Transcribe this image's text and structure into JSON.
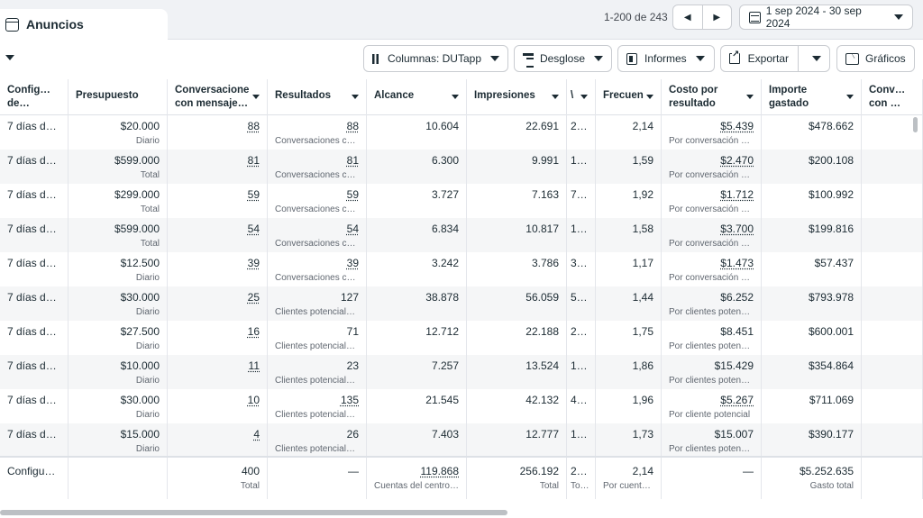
{
  "header": {
    "tab_label": "Anuncios",
    "pager_text": "1-200 de 243",
    "prev_icon": "◀",
    "next_icon": "▶",
    "date_range": "1 sep 2024 - 30 sep 2024"
  },
  "toolbar": {
    "columns_label": "Columnas: DUTapp",
    "breakdown_label": "Desglose",
    "reports_label": "Informes",
    "export_label": "Exportar",
    "charts_label": "Gráficos"
  },
  "columns": [
    {
      "label": "Configura\nde…",
      "caret": false
    },
    {
      "label": "Presupuesto",
      "caret": false
    },
    {
      "label": "Conversacione\ncon mensaje…",
      "caret": true
    },
    {
      "label": "Resultados",
      "caret": true
    },
    {
      "label": "Alcance",
      "caret": true
    },
    {
      "label": "Impresiones",
      "caret": true
    },
    {
      "label": "\\",
      "caret": true
    },
    {
      "label": "Frecuen",
      "caret": true
    },
    {
      "label": "Costo por\nresultado",
      "caret": true
    },
    {
      "label": "Importe\ngastado",
      "caret": true
    },
    {
      "label": "Conversaci\ncon mensa",
      "caret": false
    }
  ],
  "rows": [
    {
      "config": "7 días d…",
      "budget": "$20.000",
      "budget_type": "Diario",
      "conversations": "88",
      "results": "88",
      "results_type": "Conversaciones co…",
      "reach": "10.604",
      "impressions": "22.691",
      "col7": "2…",
      "frequency": "2,14",
      "cost": "$5.439",
      "cost_type": "Por conversación c…",
      "spent": "$478.662"
    },
    {
      "config": "7 días d…",
      "budget": "$599.000",
      "budget_type": "Total",
      "conversations": "81",
      "results": "81",
      "results_type": "Conversaciones co…",
      "reach": "6.300",
      "impressions": "9.991",
      "col7": "1…",
      "frequency": "1,59",
      "cost": "$2.470",
      "cost_type": "Por conversación c…",
      "spent": "$200.108"
    },
    {
      "config": "7 días d…",
      "budget": "$299.000",
      "budget_type": "Total",
      "conversations": "59",
      "results": "59",
      "results_type": "Conversaciones co…",
      "reach": "3.727",
      "impressions": "7.163",
      "col7": "7…",
      "frequency": "1,92",
      "cost": "$1.712",
      "cost_type": "Por conversación c…",
      "spent": "$100.992"
    },
    {
      "config": "7 días d…",
      "budget": "$599.000",
      "budget_type": "Total",
      "conversations": "54",
      "results": "54",
      "results_type": "Conversaciones co…",
      "reach": "6.834",
      "impressions": "10.817",
      "col7": "1…",
      "frequency": "1,58",
      "cost": "$3.700",
      "cost_type": "Por conversación c…",
      "spent": "$199.816"
    },
    {
      "config": "7 días d…",
      "budget": "$12.500",
      "budget_type": "Diario",
      "conversations": "39",
      "results": "39",
      "results_type": "Conversaciones co…",
      "reach": "3.242",
      "impressions": "3.786",
      "col7": "3…",
      "frequency": "1,17",
      "cost": "$1.473",
      "cost_type": "Por conversación c…",
      "spent": "$57.437"
    },
    {
      "config": "7 días d…",
      "budget": "$30.000",
      "budget_type": "Diario",
      "conversations": "25",
      "results": "127",
      "results_type": "Clientes potenciales…",
      "reach": "38.878",
      "impressions": "56.059",
      "col7": "5…",
      "frequency": "1,44",
      "cost": "$6.252",
      "cost_type": "Por clientes potenci…",
      "spent": "$793.978"
    },
    {
      "config": "7 días d…",
      "budget": "$27.500",
      "budget_type": "Diario",
      "conversations": "16",
      "results": "71",
      "results_type": "Clientes potenciales…",
      "reach": "12.712",
      "impressions": "22.188",
      "col7": "2…",
      "frequency": "1,75",
      "cost": "$8.451",
      "cost_type": "Por clientes potenci…",
      "spent": "$600.001"
    },
    {
      "config": "7 días d…",
      "budget": "$10.000",
      "budget_type": "Diario",
      "conversations": "11",
      "results": "23",
      "results_type": "Clientes potenciales…",
      "reach": "7.257",
      "impressions": "13.524",
      "col7": "1…",
      "frequency": "1,86",
      "cost": "$15.429",
      "cost_type": "Por clientes potenci…",
      "spent": "$354.864"
    },
    {
      "config": "7 días d…",
      "budget": "$30.000",
      "budget_type": "Diario",
      "conversations": "10",
      "results": "135",
      "results_type": "Clientes potenciale…",
      "reach": "21.545",
      "impressions": "42.132",
      "col7": "4…",
      "frequency": "1,96",
      "cost": "$5.267",
      "cost_type": "Por cliente potencial",
      "spent": "$711.069"
    },
    {
      "config": "7 días d…",
      "budget": "$15.000",
      "budget_type": "Diario",
      "conversations": "4",
      "results": "26",
      "results_type": "Clientes potenciales…",
      "reach": "7.403",
      "impressions": "12.777",
      "col7": "1…",
      "frequency": "1,73",
      "cost": "$15.007",
      "cost_type": "Por clientes potenci…",
      "spent": "$390.177"
    }
  ],
  "totals": {
    "config": "Configu…",
    "conversations": "400",
    "conversations_sub": "Total",
    "results": "—",
    "reach": "119.868",
    "reach_sub": "Cuentas del centro …",
    "impressions": "256.192",
    "impressions_sub": "Total",
    "col7": "2…",
    "col7_sub": "To…",
    "frequency": "2,14",
    "frequency_sub": "Por cuenta …",
    "cost": "—",
    "spent": "$5.252.635",
    "spent_sub": "Gasto total"
  }
}
